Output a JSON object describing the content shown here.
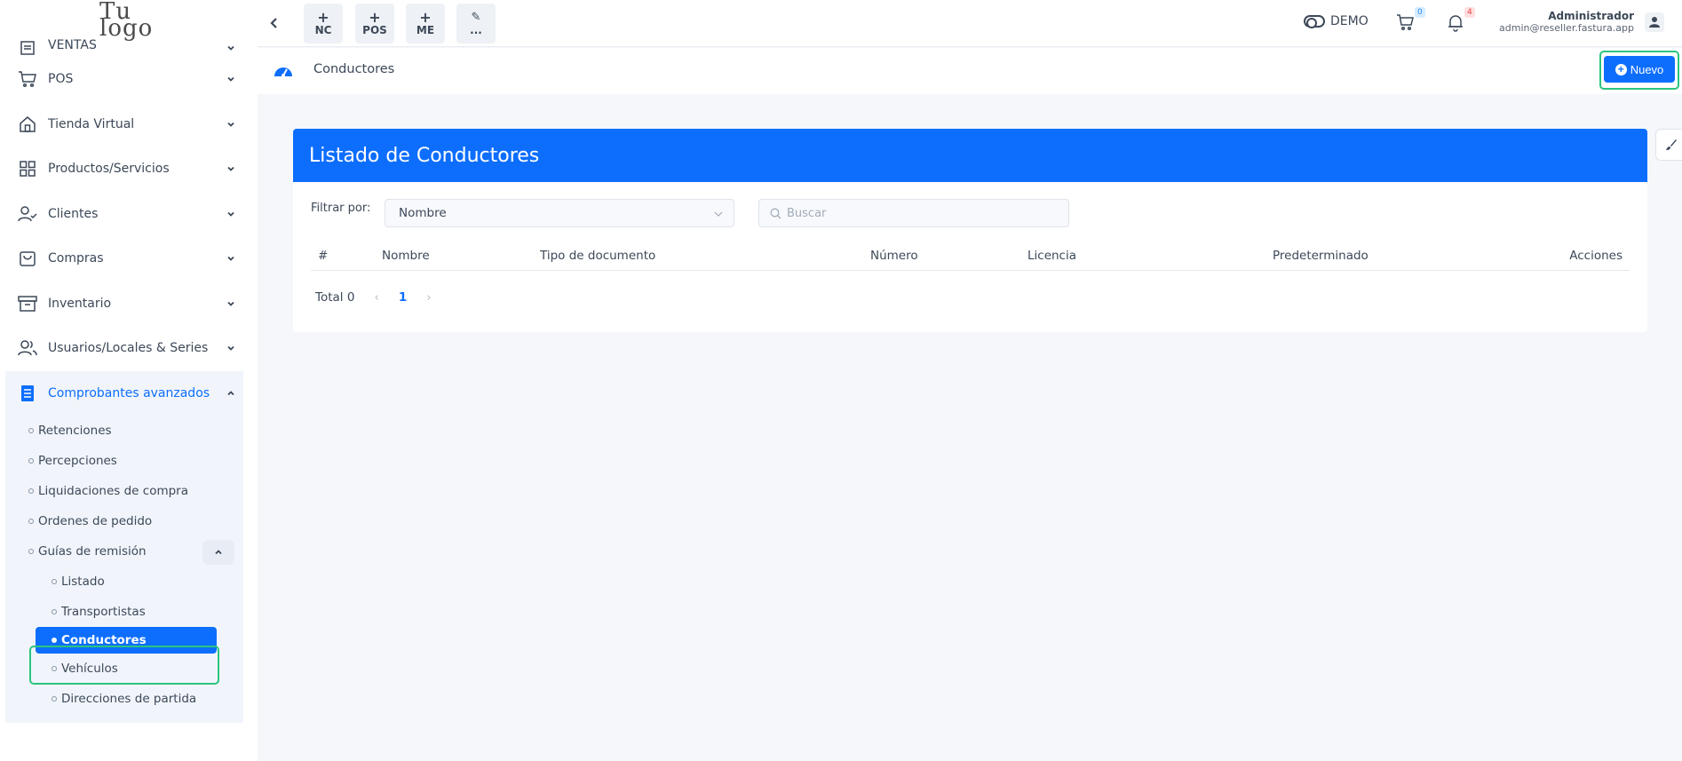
{
  "logo": {
    "line1": "Tu",
    "line2": "logo"
  },
  "sidebar": {
    "items": [
      {
        "label": "VENTAS",
        "icon": "receipt-icon"
      },
      {
        "label": "POS",
        "icon": "cart-icon"
      },
      {
        "label": "Tienda Virtual",
        "icon": "store-icon"
      },
      {
        "label": "Productos/Servicios",
        "icon": "grid-icon"
      },
      {
        "label": "Clientes",
        "icon": "user-check-icon"
      },
      {
        "label": "Compras",
        "icon": "bag-icon"
      },
      {
        "label": "Inventario",
        "icon": "archive-icon"
      },
      {
        "label": "Usuarios/Locales & Series",
        "icon": "users-icon"
      },
      {
        "label": "Comprobantes avanzados",
        "icon": "document-icon"
      }
    ],
    "sub": [
      {
        "label": "Retenciones"
      },
      {
        "label": "Percepciones"
      },
      {
        "label": "Liquidaciones de compra"
      },
      {
        "label": "Ordenes de pedido"
      },
      {
        "label": "Guías de remisión"
      }
    ],
    "sub2": [
      {
        "label": "Listado"
      },
      {
        "label": "Transportistas"
      },
      {
        "label": "Conductores"
      },
      {
        "label": "Vehículos"
      },
      {
        "label": "Direcciones de partida"
      }
    ]
  },
  "topbar": {
    "quick": [
      {
        "plus": "+",
        "label": "NC"
      },
      {
        "plus": "+",
        "label": "POS"
      },
      {
        "plus": "+",
        "label": "ME"
      },
      {
        "plus": "✎",
        "label": "..."
      }
    ],
    "demo_label": "DEMO",
    "cart_count": "0",
    "notif_count": "4",
    "user_name": "Administrador",
    "user_email": "admin@reseller.fastura.app"
  },
  "breadcrumb": {
    "current": "Conductores",
    "new_label": "Nuevo"
  },
  "card": {
    "title": "Listado de Conductores",
    "filter_label": "Filtrar por:",
    "filter_value": "Nombre",
    "search_placeholder": "Buscar",
    "columns": [
      "#",
      "Nombre",
      "Tipo de documento",
      "Número",
      "Licencia",
      "Predeterminado",
      "Acciones"
    ],
    "total": "Total 0",
    "page": "1"
  },
  "colors": {
    "primary": "#0d6efd",
    "highlight": "#2bc47e"
  }
}
